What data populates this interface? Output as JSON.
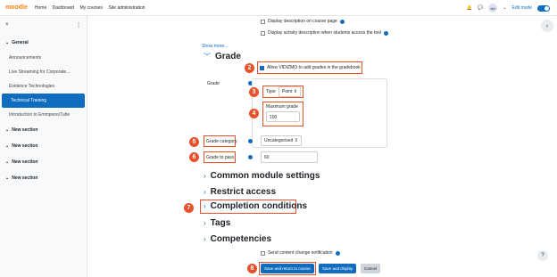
{
  "topbar": {
    "logo": "moodle",
    "nav": [
      "Home",
      "Dashboard",
      "My courses",
      "Site administration"
    ],
    "avatar": "AU",
    "edit_mode": "Edit mode"
  },
  "drawer": {
    "close": "×",
    "more": "⋮",
    "general": "General",
    "items": [
      "Announcements",
      "Live Streaming for Corporate...",
      "Evidence Technologies",
      "Technical Training",
      "Introduction to EmmpressTube"
    ],
    "sections": [
      "New section",
      "New section",
      "New section",
      "New section"
    ]
  },
  "form": {
    "display_desc": "Display description on course page",
    "display_activity": "Display activity description when students access the tool",
    "show_more": "Show more...",
    "grade_header": "Grade",
    "allow_grades": "Allow VIDIZMO to add grades in the gradebook",
    "grade_label": "Grade",
    "type_label": "Type",
    "type_value": "Point",
    "max_grade_label": "Maximum grade",
    "max_grade_value": "100",
    "grade_category_label": "Grade category",
    "grade_category_value": "Uncategorised",
    "grade_to_pass_label": "Grade to pass",
    "grade_to_pass_value": "60",
    "sections": [
      "Common module settings",
      "Restrict access",
      "Completion conditions",
      "Tags",
      "Competencies"
    ],
    "send_notification": "Send content change notification",
    "save_return": "Save and return to course",
    "save_display": "Save and display",
    "cancel": "Cancel"
  },
  "badges": [
    "2",
    "3",
    "4",
    "5",
    "6",
    "7",
    "8"
  ],
  "colors": {
    "accent": "#0f6cbf",
    "highlight": "#e8522b",
    "brand": "#f98012"
  }
}
